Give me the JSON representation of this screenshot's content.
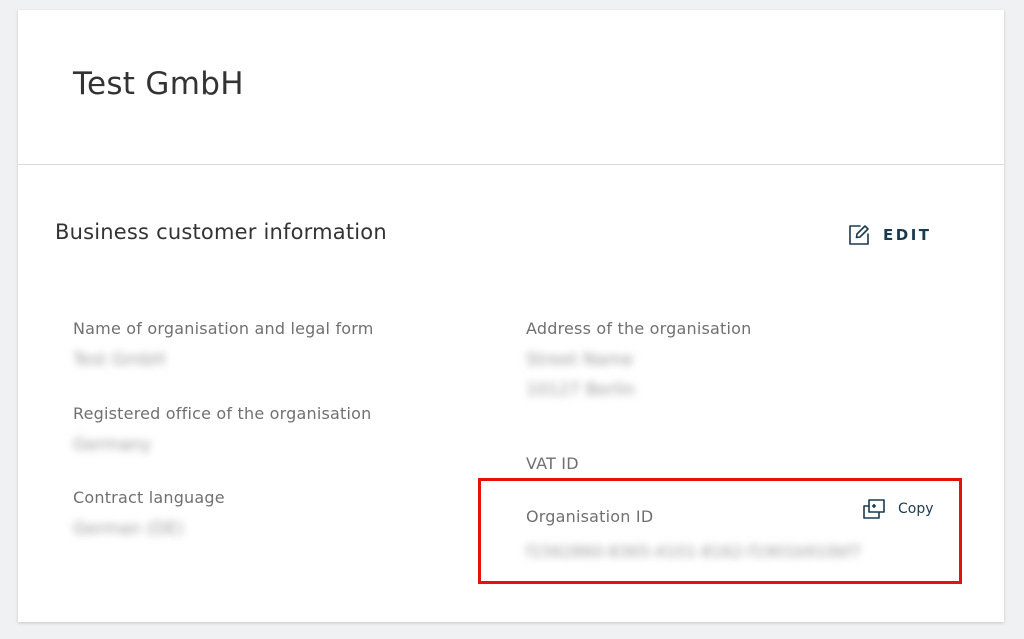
{
  "header": {
    "company_name": "Test GmbH"
  },
  "section": {
    "title": "Business customer information",
    "edit_label": "EDIT"
  },
  "fields": {
    "org_name": {
      "label": "Name of organisation and legal form",
      "value": "Test GmbH"
    },
    "registered_office": {
      "label": "Registered office of the organisation",
      "value": "Germany"
    },
    "contract_language": {
      "label": "Contract language",
      "value": "German (DE)"
    },
    "address": {
      "label": "Address of the organisation",
      "line1": "Street Name",
      "line2": "10127 Berlin"
    },
    "vat_id": {
      "label": "VAT ID"
    },
    "organisation_id": {
      "label": "Organisation ID",
      "value": "f1562860-8365-4101-8162-f1901b910bf7",
      "copy_label": "Copy"
    }
  },
  "icons": {
    "edit": "edit-icon",
    "copy": "copy-icon"
  },
  "colors": {
    "accent": "#1a3a4e",
    "highlight_border": "#e3120b",
    "label_gray": "#707070"
  }
}
